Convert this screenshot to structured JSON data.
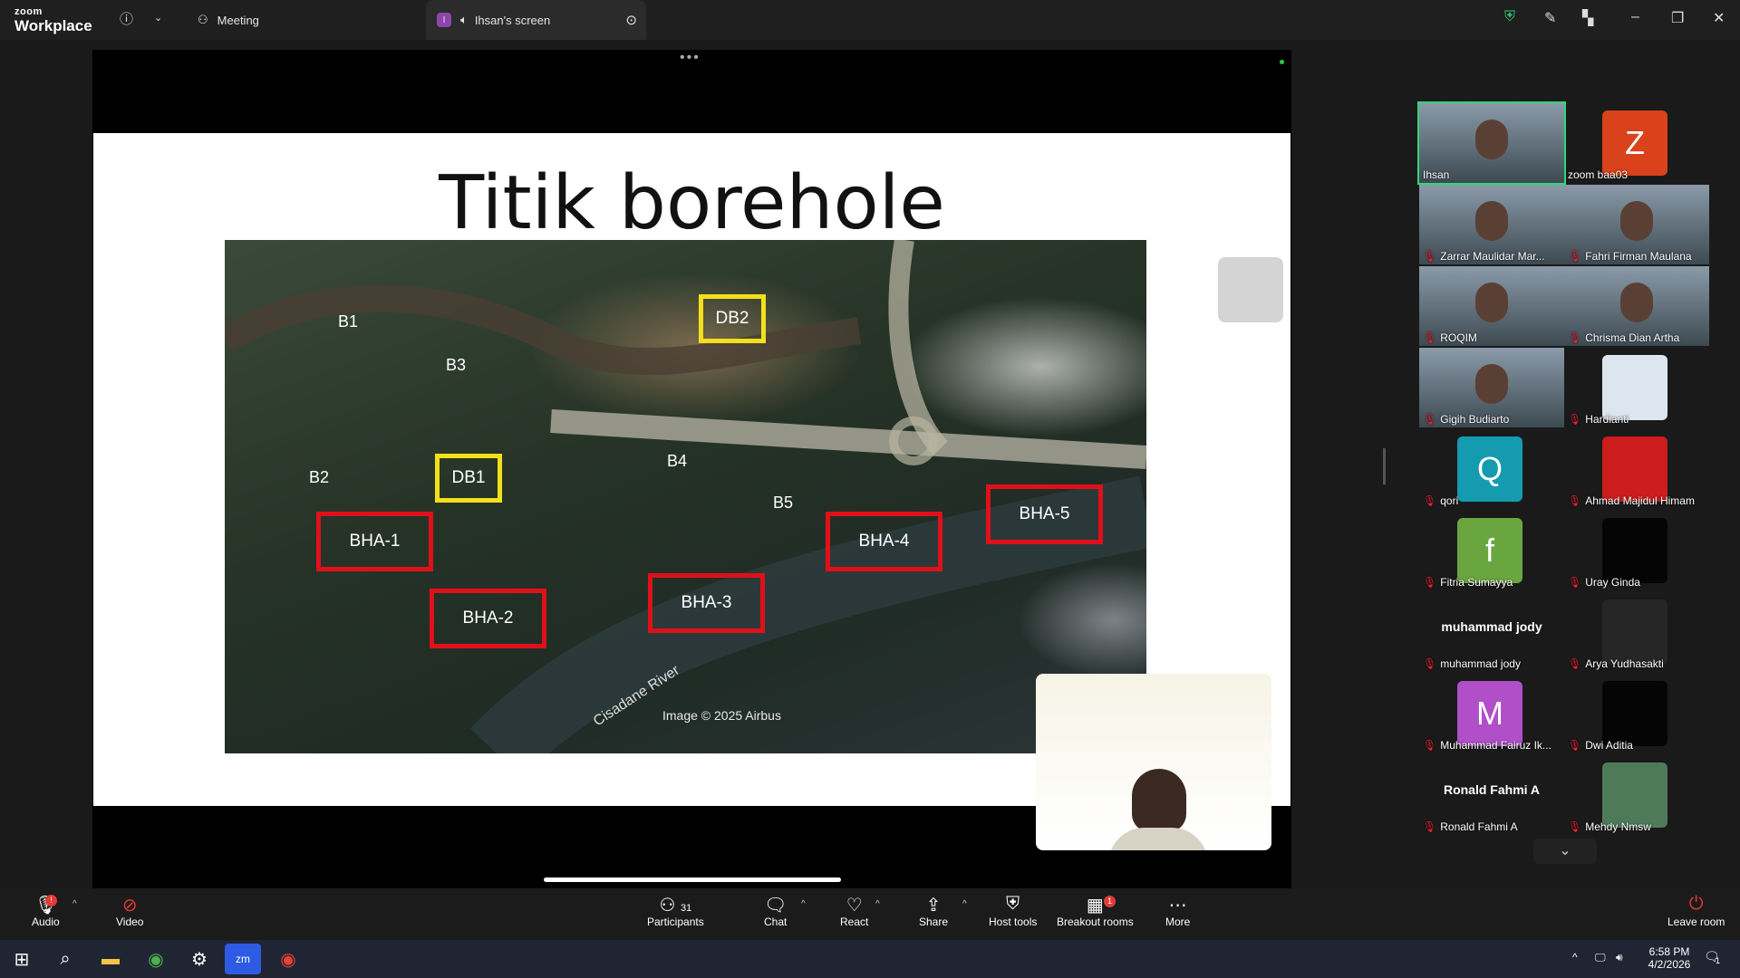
{
  "topbar": {
    "brand_small": "zoom",
    "brand_big": "Workplace",
    "meeting_tab": "Meeting",
    "share_tab": "Ihsan's screen",
    "share_badge": "I"
  },
  "slide": {
    "title": "Titik borehole",
    "map_labels": [
      "B1",
      "B2",
      "B3",
      "B4",
      "B5"
    ],
    "yellow_boxes": [
      "DB1",
      "DB2"
    ],
    "red_boxes": [
      "BHA-1",
      "BHA-2",
      "BHA-3",
      "BHA-4",
      "BHA-5"
    ],
    "river_name": "Cisadane River",
    "caption": "Image © 2025 Airbus"
  },
  "participants_panel": {
    "tiles": [
      {
        "name": "Ihsan",
        "muted": false,
        "type": "video"
      },
      {
        "name": "zoom baa03",
        "muted": false,
        "type": "avatar",
        "letter": "Z",
        "color": "#d9421a"
      },
      {
        "name": "Zarrar Maulidar Mar...",
        "muted": true,
        "type": "video"
      },
      {
        "name": "Fahri Firman Maulana",
        "muted": true,
        "type": "video"
      },
      {
        "name": "ROQIM",
        "muted": true,
        "type": "video"
      },
      {
        "name": "Chrisma Dian Artha",
        "muted": true,
        "type": "video"
      },
      {
        "name": "Gigih Budiarto",
        "muted": true,
        "type": "video"
      },
      {
        "name": "Hardianti",
        "muted": true,
        "type": "avatar",
        "letter": "",
        "color": "#dde6ef"
      },
      {
        "name": "qori",
        "muted": true,
        "type": "avatar",
        "letter": "Q",
        "color": "#159bb0"
      },
      {
        "name": "Ahmad Majidul Himam",
        "muted": true,
        "type": "avatar",
        "letter": "",
        "color": "#cc1c1c"
      },
      {
        "name": "Fitria Sumayya",
        "muted": true,
        "type": "avatar",
        "letter": "f",
        "color": "#6aa640"
      },
      {
        "name": "Uray Ginda",
        "muted": true,
        "type": "avatar",
        "letter": "",
        "color": "#050505"
      },
      {
        "name": "muhammad jody",
        "muted": true,
        "type": "nameonly",
        "bigname": "muhammad jody"
      },
      {
        "name": "Arya Yudhasakti",
        "muted": true,
        "type": "avatar",
        "letter": "",
        "color": "#262626"
      },
      {
        "name": "Muhammad Fairuz Ik...",
        "muted": true,
        "type": "avatar",
        "letter": "M",
        "color": "#b04fc8"
      },
      {
        "name": "Dwi Aditia",
        "muted": true,
        "type": "avatar",
        "letter": "",
        "color": "#050505"
      },
      {
        "name": "Ronald Fahmi A",
        "muted": true,
        "type": "nameonly",
        "bigname": "Ronald Fahmi A"
      },
      {
        "name": "Mehdy Nmsw",
        "muted": true,
        "type": "avatar",
        "letter": "",
        "color": "#4f7a5a"
      }
    ]
  },
  "toolbar": {
    "audio": "Audio",
    "video": "Video",
    "participants": "Participants",
    "participants_count": "31",
    "chat": "Chat",
    "react": "React",
    "share": "Share",
    "host_tools": "Host tools",
    "breakout": "Breakout rooms",
    "breakout_badge": "1",
    "more": "More",
    "leave": "Leave room"
  },
  "taskbar": {
    "time": "6:58 PM",
    "date": "4/2/2026",
    "notif_count": "1"
  },
  "colors": {
    "red_box": "#e0101a",
    "yellow_box": "#f3e01a",
    "toolbar_bg": "#1b1b1b"
  }
}
